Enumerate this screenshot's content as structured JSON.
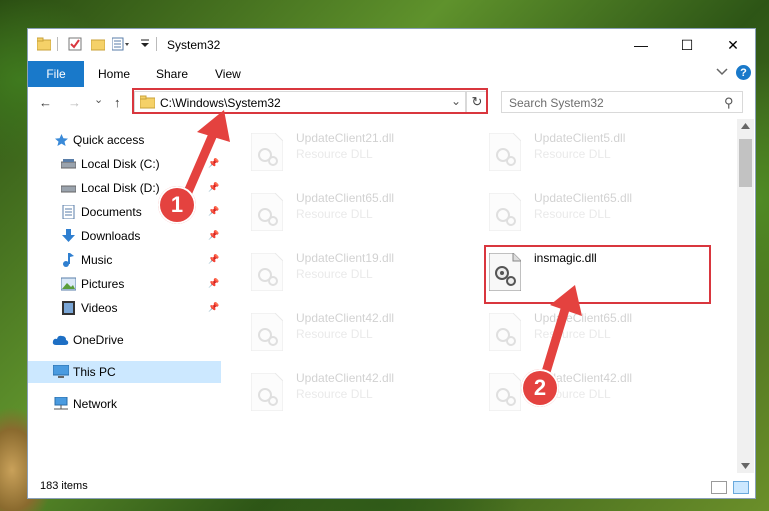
{
  "window": {
    "title": "System32",
    "controls": {
      "minimize": "—",
      "maximize": "☐",
      "close": "✕"
    }
  },
  "ribbon": {
    "file_tab": "File",
    "tabs": [
      "Home",
      "Share",
      "View"
    ],
    "expand_icon": "chevron-down-icon",
    "help_icon": "help-icon",
    "help_label": "?"
  },
  "navigation": {
    "back": "←",
    "forward": "→",
    "recent": "⌄",
    "up": "↑",
    "address": "C:\\Windows\\System32",
    "address_dropdown": "⌄",
    "refresh": "↻",
    "search_placeholder": "Search System32",
    "search_icon": "⚲"
  },
  "sidebar": {
    "items": [
      {
        "label": "Quick access",
        "icon": "star-icon",
        "pinned": false
      },
      {
        "label": "Local Disk (C:)",
        "icon": "drive-icon",
        "pinned": true
      },
      {
        "label": "Local Disk (D:)",
        "icon": "drive-icon",
        "pinned": true
      },
      {
        "label": "Documents",
        "icon": "documents-icon",
        "pinned": true
      },
      {
        "label": "Downloads",
        "icon": "downloads-icon",
        "pinned": true
      },
      {
        "label": "Music",
        "icon": "music-icon",
        "pinned": true
      },
      {
        "label": "Pictures",
        "icon": "pictures-icon",
        "pinned": true
      },
      {
        "label": "Videos",
        "icon": "videos-icon",
        "pinned": true
      },
      {
        "label": "OneDrive",
        "icon": "cloud-icon",
        "pinned": false
      },
      {
        "label": "This PC",
        "icon": "computer-icon",
        "pinned": false,
        "selected": true
      },
      {
        "label": "Network",
        "icon": "network-icon",
        "pinned": false
      }
    ]
  },
  "files": [
    {
      "name": "UpdateClient21.dll",
      "type": "Resource DLL",
      "faded": true
    },
    {
      "name": "UpdateClient5.dll",
      "type": "Resource DLL",
      "faded": true
    },
    {
      "name": "UpdateClient65.dll",
      "type": "Resource DLL",
      "faded": true
    },
    {
      "name": "UpdateClient65.dll",
      "type": "Resource DLL",
      "faded": true
    },
    {
      "name": "UpdateClient19.dll",
      "type": "Resource DLL",
      "faded": true
    },
    {
      "name": "insmagic.dll",
      "type": "",
      "faded": false,
      "highlighted": true
    },
    {
      "name": "UpdateClient42.dll",
      "type": "Resource DLL",
      "faded": true
    },
    {
      "name": "UpdateClient65.dll",
      "type": "Resource DLL",
      "faded": true
    },
    {
      "name": "UpdateClient42.dll",
      "type": "Resource DLL",
      "faded": true
    },
    {
      "name": "UpdateClient42.dll",
      "type": "Resource DLL",
      "faded": true
    }
  ],
  "status_bar": {
    "item_count": "183 items"
  },
  "annotations": {
    "step1": "1",
    "step2": "2",
    "color": "#e4423f"
  }
}
